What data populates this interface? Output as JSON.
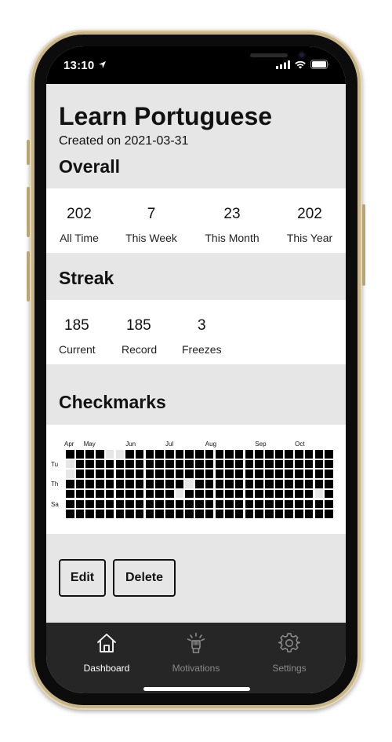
{
  "status_bar": {
    "time": "13:10"
  },
  "page": {
    "title": "Learn Portuguese",
    "created": "Created on 2021-03-31"
  },
  "overall": {
    "title": "Overall",
    "stats": [
      {
        "value": "202",
        "label": "All Time"
      },
      {
        "value": "7",
        "label": "This Week"
      },
      {
        "value": "23",
        "label": "This Month"
      },
      {
        "value": "202",
        "label": "This Year"
      }
    ]
  },
  "streak": {
    "title": "Streak",
    "stats": [
      {
        "value": "185",
        "label": "Current"
      },
      {
        "value": "185",
        "label": "Record"
      },
      {
        "value": "3",
        "label": "Freezes"
      }
    ]
  },
  "checkmarks": {
    "title": "Checkmarks",
    "month_labels": [
      "Apr",
      "May",
      "Jun",
      "Jul",
      "Aug",
      "Sep",
      "Oct"
    ],
    "day_labels": [
      "Tu",
      "Th",
      "Sa"
    ],
    "missed_days": [
      [
        0,
        4
      ],
      [
        0,
        5
      ],
      [
        1,
        0
      ],
      [
        2,
        0
      ],
      [
        3,
        12
      ],
      [
        4,
        11
      ],
      [
        4,
        25
      ]
    ]
  },
  "actions": {
    "edit": "Edit",
    "delete": "Delete"
  },
  "tabs": [
    {
      "label": "Dashboard",
      "icon": "home-icon",
      "active": true
    },
    {
      "label": "Motivations",
      "icon": "motivation-icon",
      "active": false
    },
    {
      "label": "Settings",
      "icon": "gear-icon",
      "active": false
    }
  ],
  "colors": {
    "screen_bg": "#e6e6e6",
    "panel_bg": "#ffffff",
    "tabbar_bg": "#262626",
    "active_tab": "#ffffff",
    "inactive_tab": "#8a8a8a"
  }
}
